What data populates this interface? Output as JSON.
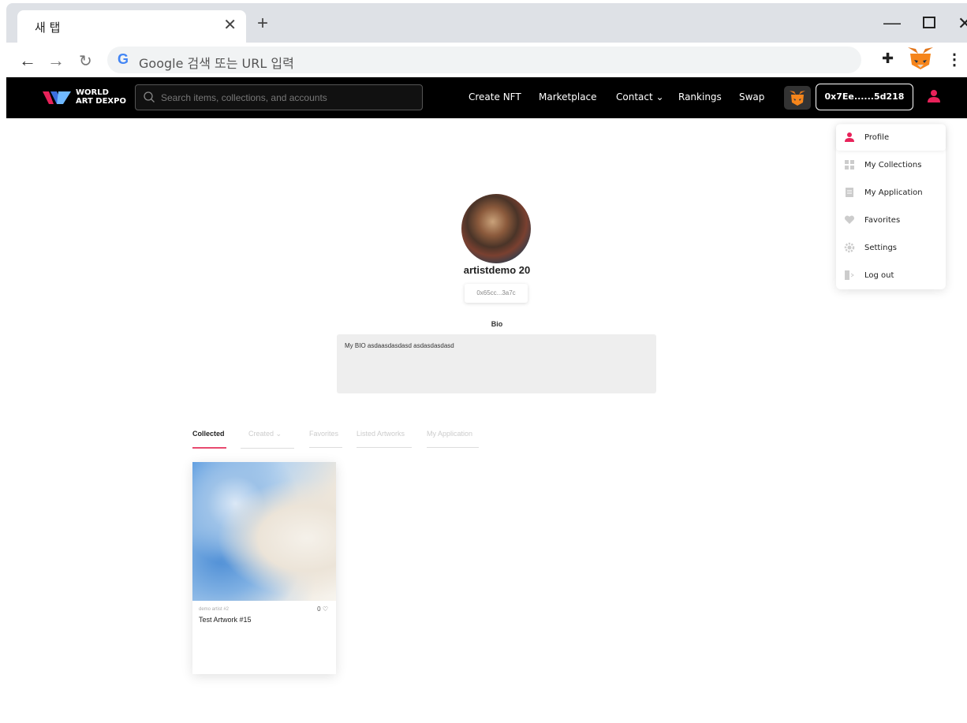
{
  "browser": {
    "tab_title": "새 탭",
    "tab_close": "✕",
    "new_tab": "+",
    "omnibox_placeholder": "Google 검색 또는 URL 입력",
    "google_logo": "G",
    "menu_dots": "⋮"
  },
  "header": {
    "brand_line1": "WORLD",
    "brand_line2": "ART DEXPO",
    "search_placeholder": "Search items, collections, and accounts",
    "nav": [
      "Create NFT",
      "Marketplace",
      "Contact ⌄",
      "Rankings",
      "Swap"
    ],
    "wallet": "0x7Ee......5d218"
  },
  "profile": {
    "username": "artistdemo 20",
    "address": "0x65cc...3a7c",
    "bio_label": "Bio",
    "bio_text": "My BIO asdaasdasdasd asdasdasdasd"
  },
  "tabs": [
    "Collected",
    "Created ⌄",
    "Favorites",
    "Listed Artworks",
    "My Application"
  ],
  "card": {
    "artist": "demo artist #2",
    "likes": "0 ♡",
    "title": "Test Artwork #15"
  },
  "dropdown": [
    "Profile",
    "My Collections",
    "My Application",
    "Favorites",
    "Settings",
    "Log out"
  ],
  "colors": {
    "accent": "#e8225a",
    "header_bg": "#000000"
  }
}
